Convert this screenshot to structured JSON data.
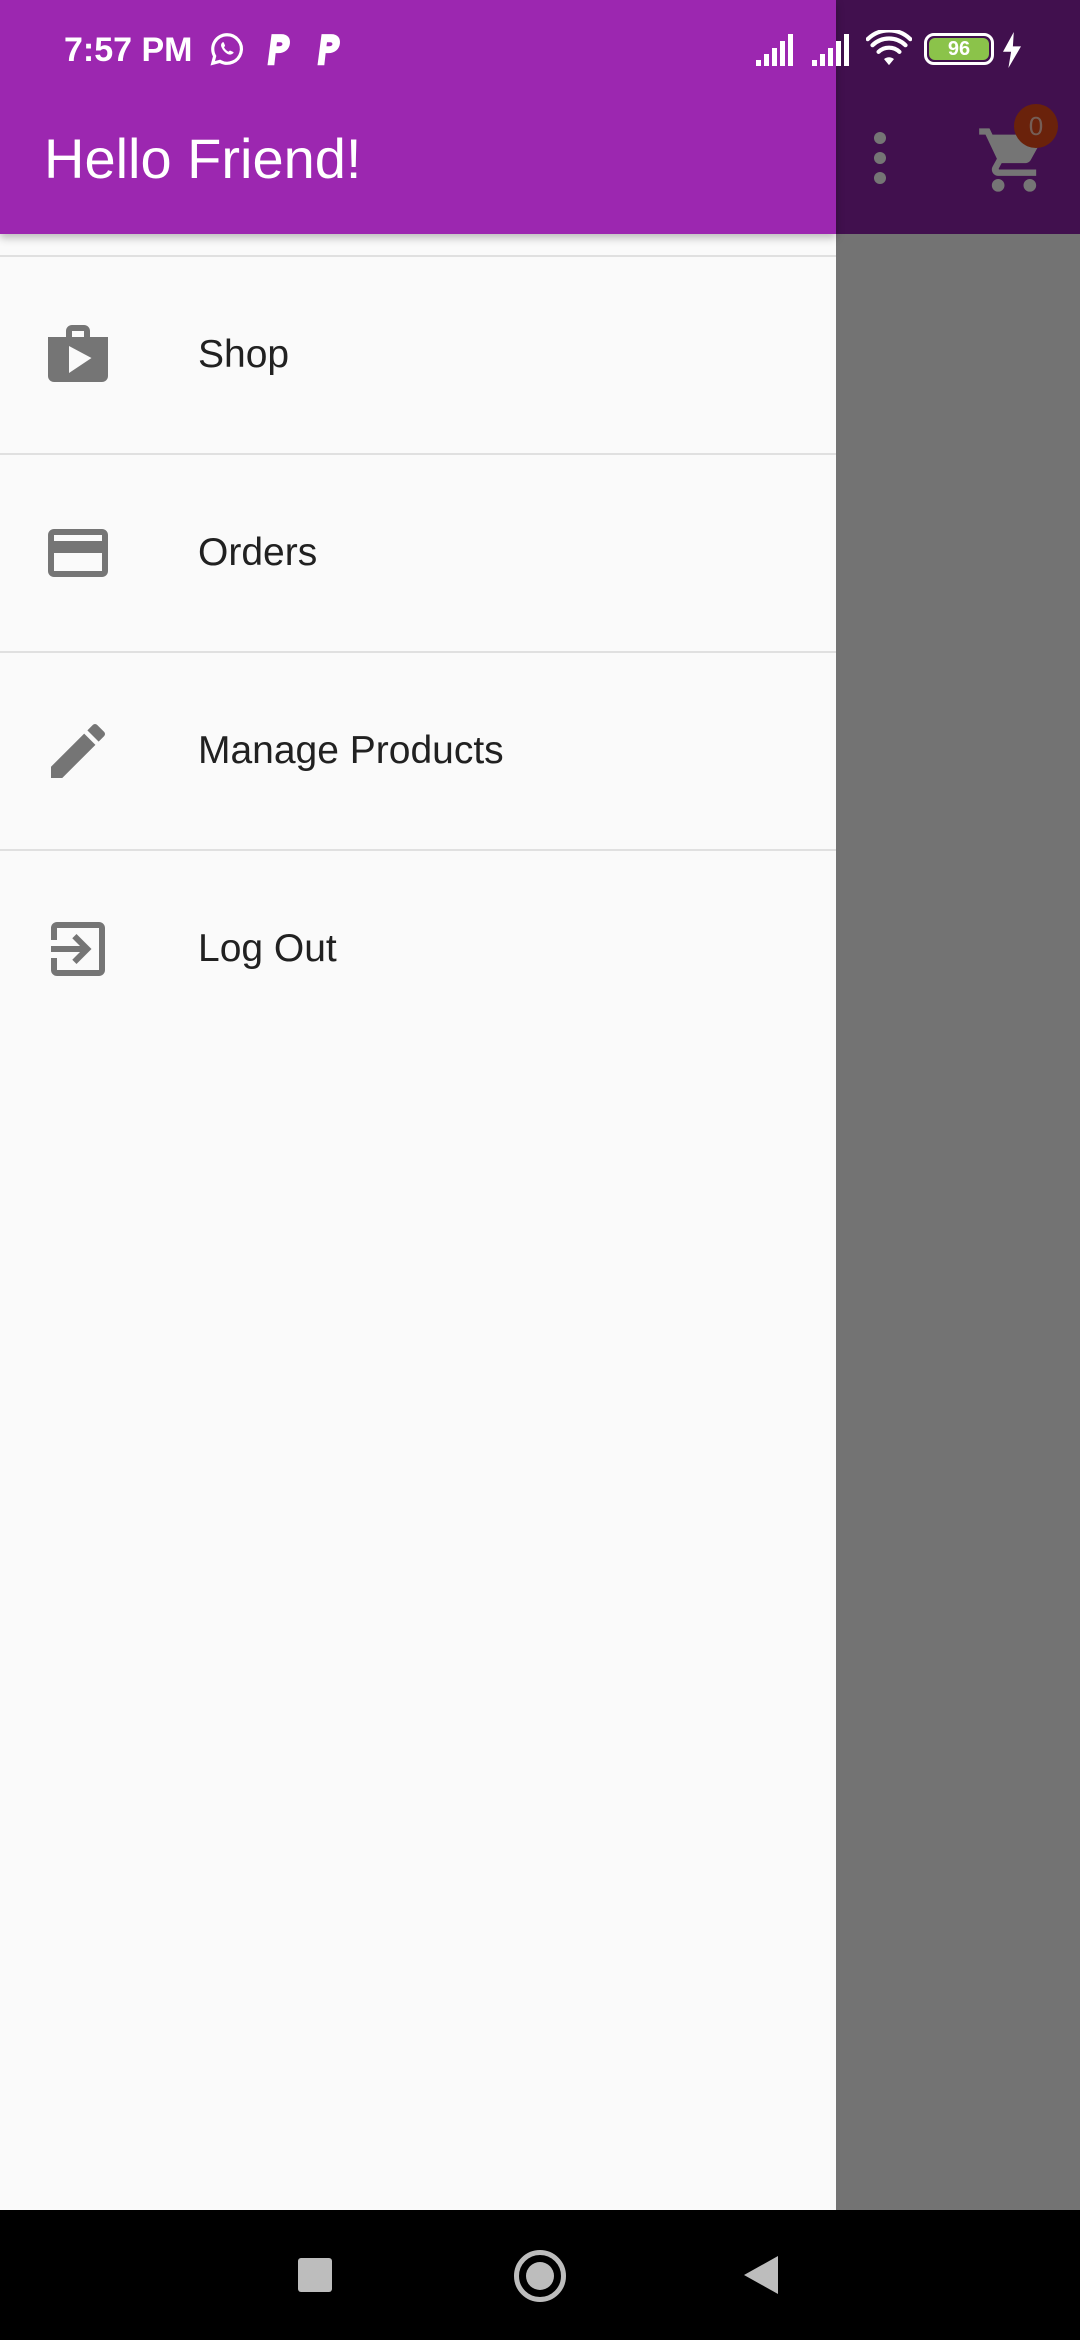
{
  "status_bar": {
    "time": "7:57 PM",
    "battery_level": "96",
    "icons": [
      "whatsapp-icon",
      "p-icon",
      "p-icon",
      "signal-icon",
      "signal-icon",
      "wifi-icon",
      "battery-icon",
      "charging-icon"
    ]
  },
  "app_bar": {
    "cart_count": "0",
    "icons": [
      "more-vert-icon",
      "shopping-cart-icon"
    ]
  },
  "drawer": {
    "title": "Hello Friend!",
    "items": [
      {
        "label": "Shop",
        "icon": "shop-icon"
      },
      {
        "label": "Orders",
        "icon": "credit-card-icon"
      },
      {
        "label": "Manage Products",
        "icon": "edit-icon"
      },
      {
        "label": "Log Out",
        "icon": "exit-icon"
      }
    ]
  },
  "colors": {
    "primary": "#9c27b0",
    "primary_dark": "#7b1fa2",
    "badge": "#e64a19",
    "icon_gray": "#757575"
  }
}
